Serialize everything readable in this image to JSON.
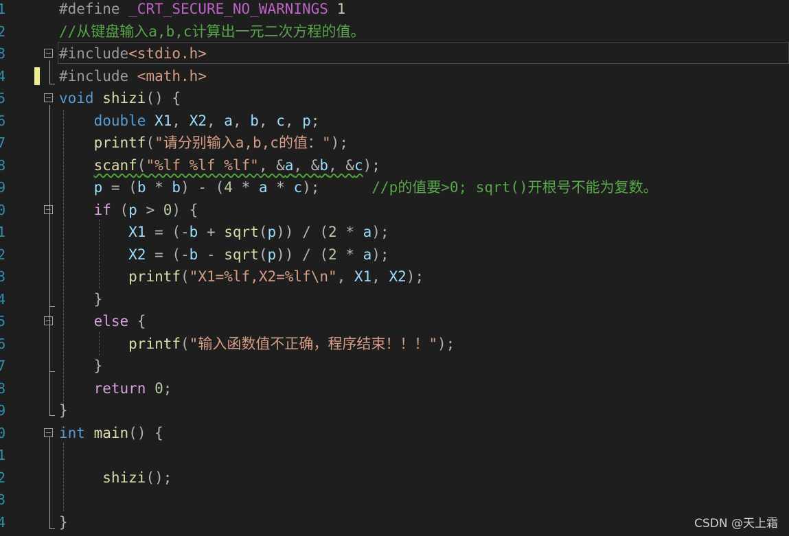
{
  "editor": {
    "line_numbers": [
      "1",
      "2",
      "3",
      "4",
      "5",
      "6",
      "7",
      "8",
      "9",
      "0",
      "1",
      "2",
      "3",
      "4",
      "5",
      "6",
      "7",
      "8",
      "9",
      "0",
      "1",
      "2",
      "3",
      "4"
    ],
    "lines": [
      [
        [
          "pp",
          "#define "
        ],
        [
          "mac",
          "_CRT_SECURE_NO_WARNINGS"
        ],
        [
          "num",
          " 1"
        ]
      ],
      [
        [
          "cm",
          "//从键盘输入a,b,c计算出一元二次方程的值。"
        ]
      ],
      [
        [
          "pp",
          "#include"
        ],
        [
          "str",
          "<stdio.h>"
        ]
      ],
      [
        [
          "pp",
          "#include "
        ],
        [
          "str",
          "<math.h>"
        ]
      ],
      [
        [
          "kw",
          "void"
        ],
        [
          "op",
          " "
        ],
        [
          "fn",
          "shizi"
        ],
        [
          "op",
          "() {"
        ]
      ],
      [
        [
          "op",
          "    "
        ],
        [
          "kw",
          "double"
        ],
        [
          "op",
          " "
        ],
        [
          "var",
          "X1"
        ],
        [
          "op",
          ", "
        ],
        [
          "var",
          "X2"
        ],
        [
          "op",
          ", "
        ],
        [
          "var",
          "a"
        ],
        [
          "op",
          ", "
        ],
        [
          "var",
          "b"
        ],
        [
          "op",
          ", "
        ],
        [
          "var",
          "c"
        ],
        [
          "op",
          ", "
        ],
        [
          "var",
          "p"
        ],
        [
          "op",
          ";"
        ]
      ],
      [
        [
          "op",
          "    "
        ],
        [
          "fn",
          "printf"
        ],
        [
          "op",
          "("
        ],
        [
          "str",
          "\"请分别输入a,b,c的值：\""
        ],
        [
          "op",
          ");"
        ]
      ],
      [
        [
          "op",
          "    "
        ],
        [
          "fn sq",
          "scanf"
        ],
        [
          "op sq",
          "("
        ],
        [
          "str sq",
          "\"%lf %lf %lf\""
        ],
        [
          "op sq",
          ", &"
        ],
        [
          "var sq",
          "a"
        ],
        [
          "op sq",
          ", &"
        ],
        [
          "var sq",
          "b"
        ],
        [
          "op sq",
          ", &"
        ],
        [
          "var sq",
          "c"
        ],
        [
          "op",
          ");"
        ]
      ],
      [
        [
          "op",
          "    "
        ],
        [
          "var",
          "p"
        ],
        [
          "op",
          " = ("
        ],
        [
          "var",
          "b"
        ],
        [
          "op",
          " * "
        ],
        [
          "var",
          "b"
        ],
        [
          "op",
          ") - ("
        ],
        [
          "num",
          "4"
        ],
        [
          "op",
          " * "
        ],
        [
          "var",
          "a"
        ],
        [
          "op",
          " * "
        ],
        [
          "var",
          "c"
        ],
        [
          "op",
          ");      "
        ],
        [
          "cm",
          "//p的值要>0; sqrt()开根号不能为复数。"
        ]
      ],
      [
        [
          "op",
          "    "
        ],
        [
          "ctl",
          "if"
        ],
        [
          "op",
          " ("
        ],
        [
          "var",
          "p"
        ],
        [
          "op",
          " > "
        ],
        [
          "num",
          "0"
        ],
        [
          "op",
          ") {"
        ]
      ],
      [
        [
          "op",
          "        "
        ],
        [
          "var",
          "X1"
        ],
        [
          "op",
          " = (-"
        ],
        [
          "var",
          "b"
        ],
        [
          "op",
          " + "
        ],
        [
          "fn",
          "sqrt"
        ],
        [
          "op",
          "("
        ],
        [
          "var",
          "p"
        ],
        [
          "op",
          ")) / ("
        ],
        [
          "num",
          "2"
        ],
        [
          "op",
          " * "
        ],
        [
          "var",
          "a"
        ],
        [
          "op",
          ");"
        ]
      ],
      [
        [
          "op",
          "        "
        ],
        [
          "var",
          "X2"
        ],
        [
          "op",
          " = (-"
        ],
        [
          "var",
          "b"
        ],
        [
          "op",
          " - "
        ],
        [
          "fn",
          "sqrt"
        ],
        [
          "op",
          "("
        ],
        [
          "var",
          "p"
        ],
        [
          "op",
          ")) / ("
        ],
        [
          "num",
          "2"
        ],
        [
          "op",
          " * "
        ],
        [
          "var",
          "a"
        ],
        [
          "op",
          ");"
        ]
      ],
      [
        [
          "op",
          "        "
        ],
        [
          "fn",
          "printf"
        ],
        [
          "op",
          "("
        ],
        [
          "str",
          "\"X1=%lf,X2=%lf\\n\""
        ],
        [
          "op",
          ", "
        ],
        [
          "var",
          "X1"
        ],
        [
          "op",
          ", "
        ],
        [
          "var",
          "X2"
        ],
        [
          "op",
          ");"
        ]
      ],
      [
        [
          "op",
          "    }"
        ]
      ],
      [
        [
          "op",
          "    "
        ],
        [
          "ctl",
          "else"
        ],
        [
          "op",
          " {"
        ]
      ],
      [
        [
          "op",
          "        "
        ],
        [
          "fn",
          "printf"
        ],
        [
          "op",
          "("
        ],
        [
          "str",
          "\"输入函数值不正确，程序结束！！！\""
        ],
        [
          "op",
          ");"
        ]
      ],
      [
        [
          "op",
          "    }"
        ]
      ],
      [
        [
          "op",
          "    "
        ],
        [
          "ctl",
          "return"
        ],
        [
          "op",
          " "
        ],
        [
          "num",
          "0"
        ],
        [
          "op",
          ";"
        ]
      ],
      [
        [
          "op",
          "}"
        ]
      ],
      [
        [
          "kw",
          "int"
        ],
        [
          "op",
          " "
        ],
        [
          "fn",
          "main"
        ],
        [
          "op",
          "() {"
        ]
      ],
      [
        [
          "op",
          ""
        ]
      ],
      [
        [
          "op",
          "     "
        ],
        [
          "fn",
          "shizi"
        ],
        [
          "op",
          "();"
        ]
      ],
      [
        [
          "op",
          ""
        ]
      ],
      [
        [
          "op",
          "}"
        ]
      ]
    ]
  },
  "watermark": "CSDN @天上霜"
}
